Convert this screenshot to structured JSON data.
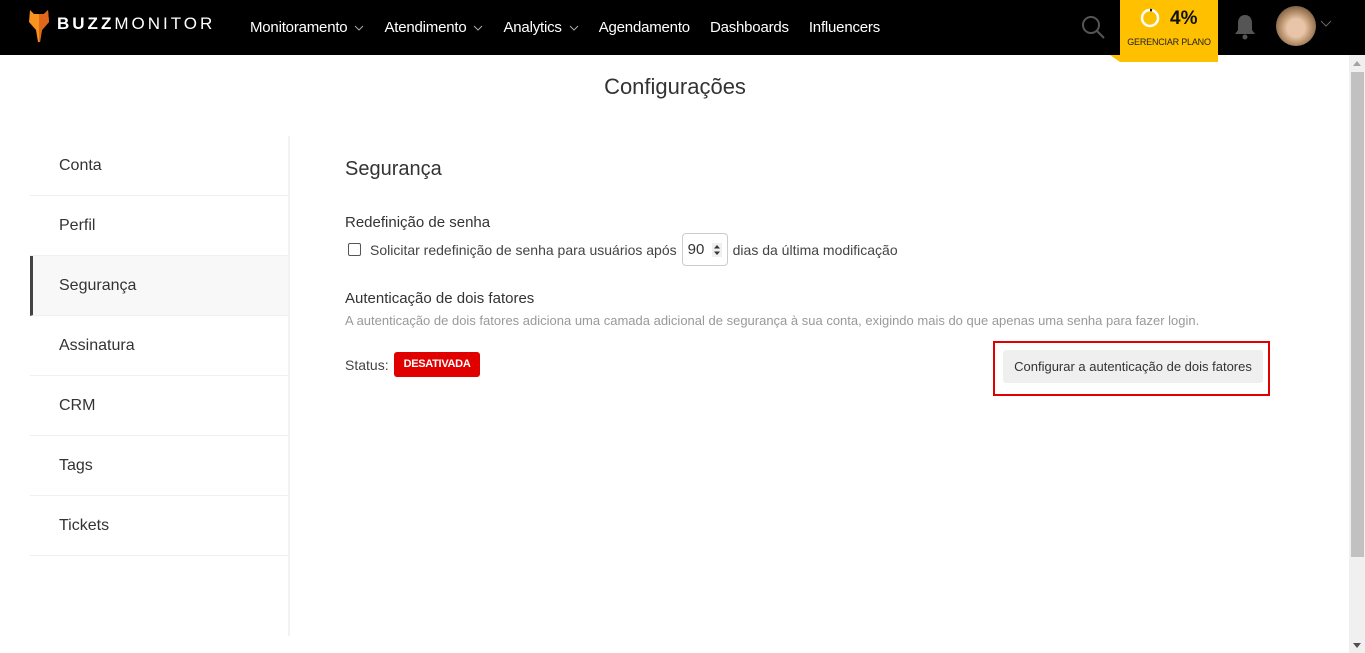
{
  "brand": {
    "name_bold": "BUZZ",
    "name_light": "MONITOR",
    "logo_color": "#f7931e"
  },
  "nav": {
    "items": [
      {
        "label": "Monitoramento",
        "has_dropdown": true
      },
      {
        "label": "Atendimento",
        "has_dropdown": true
      },
      {
        "label": "Analytics",
        "has_dropdown": true
      },
      {
        "label": "Agendamento",
        "has_dropdown": false
      },
      {
        "label": "Dashboards",
        "has_dropdown": false
      },
      {
        "label": "Influencers",
        "has_dropdown": false
      }
    ],
    "search_icon": "search-icon",
    "plan": {
      "usage_percent_label": "4%",
      "usage_fraction": 0.04,
      "label": "GERENCIAR PLANO",
      "color": "#ffc000"
    },
    "notifications_icon": "bell-icon",
    "avatar_icon": "user-avatar"
  },
  "page": {
    "title": "Configurações"
  },
  "sidebar": {
    "items": [
      {
        "label": "Conta",
        "active": false
      },
      {
        "label": "Perfil",
        "active": false
      },
      {
        "label": "Segurança",
        "active": true
      },
      {
        "label": "Assinatura",
        "active": false
      },
      {
        "label": "CRM",
        "active": false
      },
      {
        "label": "Tags",
        "active": false
      },
      {
        "label": "Tickets",
        "active": false
      }
    ]
  },
  "security": {
    "title": "Segurança",
    "password_reset": {
      "title": "Redefinição de senha",
      "checkbox_label": "Solicitar redefinição de senha para usuários após",
      "checked": false,
      "days_value": "90",
      "suffix": "dias da última modificação"
    },
    "two_factor": {
      "title": "Autenticação de dois fatores",
      "description": "A autenticação de dois fatores adiciona uma camada adicional de segurança à sua conta, exigindo mais do que apenas uma senha para fazer login.",
      "status_label": "Status:",
      "status_value": "DESATIVADA",
      "status_color": "#e00000",
      "configure_button": "Configurar a autenticação de dois fatores"
    }
  }
}
